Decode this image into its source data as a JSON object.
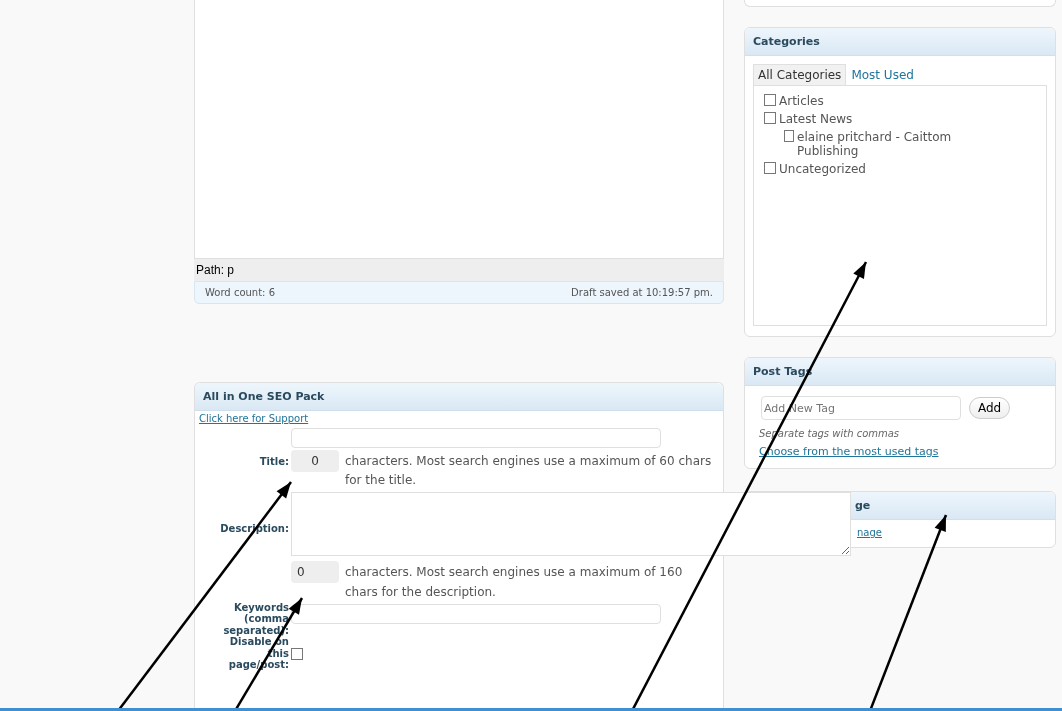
{
  "editor": {
    "path": "Path: p",
    "word_count": "Word count: 6",
    "draft_status": "Draft saved at 10:19:57 pm."
  },
  "seo_pack": {
    "title": "All in One SEO Pack",
    "support_link": "Click here for Support",
    "fields": [
      {
        "kind": "counted-input",
        "label": "Title:",
        "counter": "0",
        "note": "characters. Most search engines use a maximum of 60 chars for the title."
      },
      {
        "kind": "counted-textarea",
        "label": "Description:",
        "counter": "0",
        "note": "characters. Most search engines use a maximum of 160 chars for the description."
      },
      {
        "kind": "input",
        "label": "Keywords (comma separated):"
      },
      {
        "kind": "checkbox",
        "label": "Disable on this page/post:",
        "checked": false
      }
    ]
  },
  "categories": {
    "title": "Categories",
    "tabs": [
      {
        "label": "All Categories",
        "selected": true
      },
      {
        "label": "Most Used",
        "selected": false
      }
    ],
    "items": [
      {
        "label": "Articles",
        "checked": false
      },
      {
        "label": "Latest News",
        "checked": false,
        "children": [
          {
            "label": "elaine pritchard - Caittom Publishing",
            "checked": false
          }
        ]
      },
      {
        "label": "Uncategorized",
        "checked": false
      }
    ]
  },
  "post_tags": {
    "title": "Post Tags",
    "placeholder": "Add New Tag",
    "button": "Add",
    "hint": "Separate tags with commas",
    "link": "Choose from the most used tags"
  },
  "partial_panel": {
    "title": "ge",
    "link": "nage"
  }
}
